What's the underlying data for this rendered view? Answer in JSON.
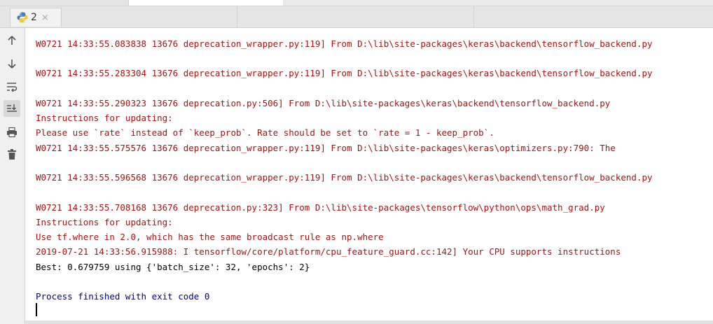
{
  "tab": {
    "label": "2",
    "close": "×",
    "icon": "python-icon"
  },
  "toolbar": {
    "icons": [
      "up-arrow-icon",
      "down-arrow-icon",
      "soft-wrap-icon",
      "scroll-to-end-icon",
      "print-icon",
      "trash-icon"
    ]
  },
  "console": {
    "lines": [
      "W0721 14:33:55.083838 13676 deprecation_wrapper.py:119] From D:\\lib\\site-packages\\keras\\backend\\tensorflow_backend.py",
      "W0721 14:33:55.283304 13676 deprecation_wrapper.py:119] From D:\\lib\\site-packages\\keras\\backend\\tensorflow_backend.py",
      "W0721 14:33:55.290323 13676 deprecation.py:506] From D:\\lib\\site-packages\\keras\\backend\\tensorflow_backend.py",
      "Instructions for updating:",
      "Please use `rate` instead of `keep_prob`. Rate should be set to `rate = 1 - keep_prob`.",
      "W0721 14:33:55.575576 13676 deprecation_wrapper.py:119] From D:\\lib\\site-packages\\keras\\optimizers.py:790: The",
      "W0721 14:33:55.596568 13676 deprecation_wrapper.py:119] From D:\\lib\\site-packages\\keras\\backend\\tensorflow_backend.py",
      "W0721 14:33:55.708168 13676 deprecation.py:323] From D:\\lib\\site-packages\\tensorflow\\python\\ops\\math_grad.py",
      "Instructions for updating:",
      "Use tf.where in 2.0, which has the same broadcast rule as np.where",
      "2019-07-21 14:33:56.915988: I tensorflow/core/platform/cpu_feature_guard.cc:142] Your CPU supports instructions",
      "Best: 0.679759 using {'batch_size': 32, 'epochs': 2}",
      "Process finished with exit code 0"
    ]
  },
  "colors": {
    "stderr": "#a31515",
    "stdout": "#000000",
    "process": "#000080"
  }
}
